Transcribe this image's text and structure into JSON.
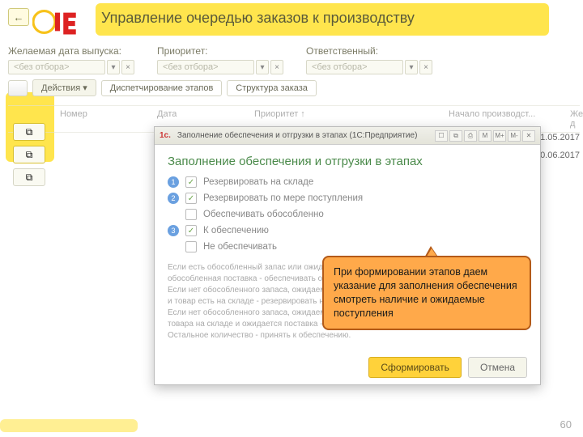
{
  "header": {
    "title": "Управление очередью заказов к производству"
  },
  "filters": {
    "release_date": {
      "label": "Желаемая дата выпуска:",
      "value": "<без отбора>"
    },
    "priority": {
      "label": "Приоритет:",
      "value": "<без отбора>"
    },
    "responsible": {
      "label": "Ответственный:",
      "value": "<без отбора>"
    }
  },
  "toolbar": {
    "actions": "Действия",
    "dispatch": "Диспетчирование этапов",
    "structure": "Структура заказа"
  },
  "table": {
    "cols": [
      "",
      "Номер",
      "Дата",
      "Приоритет  ↑",
      "Начало производст...",
      "Желаемая д"
    ]
  },
  "right_col": {
    "d1": "1.05.2017",
    "d2": "0.06.2017"
  },
  "dialog": {
    "tb_title": "Заполнение обеспечения и отгрузки в этапах  (1С:Предприятие)",
    "tb_icons": [
      "☐",
      "⧉",
      "⎙",
      "M",
      "M+",
      "M-",
      "✕"
    ],
    "heading": "Заполнение обеспечения и отгрузки в этапах",
    "options": [
      {
        "n": "1",
        "checked": true,
        "label": "Резервировать на складе"
      },
      {
        "n": "2",
        "checked": true,
        "label": "Резервировать по мере поступления"
      },
      {
        "n": "",
        "checked": false,
        "label": "Обеспечивать обособленно"
      },
      {
        "n": "3",
        "checked": true,
        "label": "К обеспечению"
      },
      {
        "n": "",
        "checked": false,
        "label": "Не обеспечивать"
      }
    ],
    "help": [
      "Если есть обособленный запас или ожид",
      "обособленная поставка - обеспечивать о",
      "Если нет обособленного запаса, ожидаемо",
      "и товар есть на складе - резервировать н",
      "Если нет обособленного запаса, ожидаемо",
      "товара на складе и ожидается поставка -",
      "Остальное количество - принять к обеспечению."
    ],
    "primary": "Сформировать",
    "secondary": "Отмена"
  },
  "callout": {
    "text": "При формировании этапов даем указание для заполнения обеспечения смотреть наличие и ожидаемые поступления"
  },
  "slide_number": "60"
}
